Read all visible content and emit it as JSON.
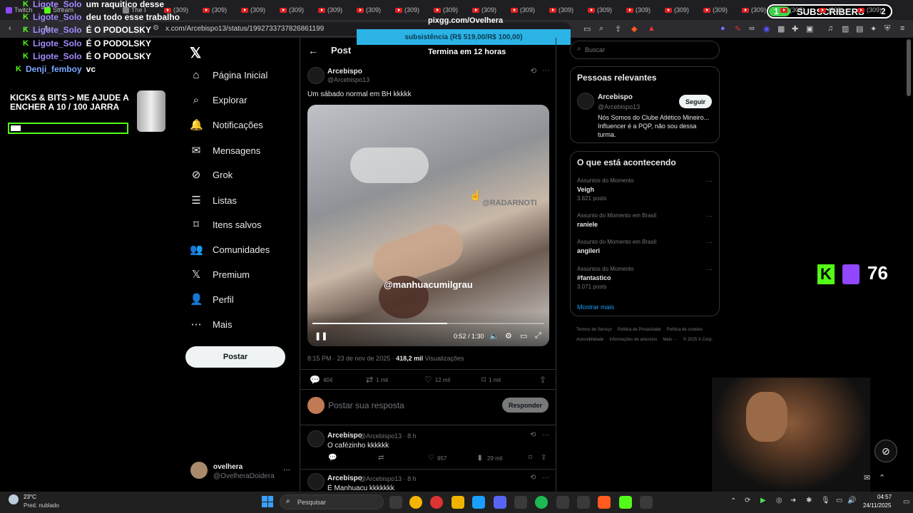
{
  "browser": {
    "tabs": [
      "Twitch",
      "Stream",
      "The I",
      "(309)",
      "(309)",
      "(309)",
      "(309)",
      "(309)",
      "(309)",
      "(309)",
      "(309)",
      "(309)",
      "(309)",
      "(309)",
      "(309)",
      "(309)",
      "(309)",
      "(309)",
      "(309)",
      "(309)",
      "(309)",
      "(309)"
    ],
    "url": "x.com/Arcebispo13/status/1992733737826861199"
  },
  "overlay": {
    "pix_title": "pixgg.com/Ovelhera",
    "pix_goal": "subsistência (R$ 519,00/R$ 100,00)",
    "pix_ends": "Termina em 12 horas",
    "subs_left": "1",
    "subs_label": "SUBSCRIBERS",
    "subs_right": "2",
    "chat": [
      {
        "user": "Ligote_Solo",
        "msg": "um raquitico desse"
      },
      {
        "user": "Ligote_Solo",
        "msg": "deu todo esse trabalho"
      },
      {
        "user": "Ligote_Solo",
        "msg": "É O PODOLSKY"
      },
      {
        "user": "Ligote_Solo",
        "msg": "É O PODOLSKY"
      },
      {
        "user": "Ligote_Solo",
        "msg": "É O PODOLSKY"
      },
      {
        "user": "Denji_femboy",
        "msg": "vc"
      }
    ],
    "goal_text": "KICKS & BITS > ME AJUDE A ENCHER A  10   / 100 JARRA",
    "viewer_count": "76"
  },
  "x_nav": {
    "items": [
      {
        "label": "Página Inicial",
        "icon": "home-icon"
      },
      {
        "label": "Explorar",
        "icon": "search-icon"
      },
      {
        "label": "Notificações",
        "icon": "bell-icon"
      },
      {
        "label": "Mensagens",
        "icon": "mail-icon"
      },
      {
        "label": "Grok",
        "icon": "grok-icon"
      },
      {
        "label": "Listas",
        "icon": "list-icon"
      },
      {
        "label": "Itens salvos",
        "icon": "bookmark-icon"
      },
      {
        "label": "Comunidades",
        "icon": "communities-icon"
      },
      {
        "label": "Premium",
        "icon": "x-icon"
      },
      {
        "label": "Perfil",
        "icon": "profile-icon"
      },
      {
        "label": "Mais",
        "icon": "more-icon"
      }
    ],
    "post_button": "Postar",
    "account_name": "ovelhera",
    "account_handle": "@OvelheraDoidera"
  },
  "post": {
    "header": "Post",
    "author": "Arcebispo",
    "handle": "@Arcebispo13",
    "text": "Um sábado normal em BH kkkkk",
    "video_watermark": "@manhuacumilgrau",
    "video_watermark2": "@RADARNOTI",
    "video_time": "0:52 / 1:30",
    "video_progress": 0.58,
    "meta_time": "8:15 PM · 23 de nov de 2025",
    "views": "418,2 mil",
    "views_label": "Visualizações",
    "replies": "404",
    "reposts": "1 mil",
    "likes": "12 mil",
    "bookmarks": "1 mil",
    "reply_placeholder": "Postar sua resposta",
    "reply_button": "Responder"
  },
  "replies": [
    {
      "author": "Arcebispo",
      "handle": "@Arcebispo13 · 8 h",
      "text": "O cafézinho kkkkkk",
      "likes": "957",
      "views": "29 mil"
    },
    {
      "author": "Arcebispo",
      "handle": "@Arcebispo13 · 8 h",
      "text": "É Manhuacu kkkkkkk"
    }
  ],
  "sidebar": {
    "search_placeholder": "Buscar",
    "relevant_title": "Pessoas relevantes",
    "relevant_name": "Arcebispo",
    "relevant_handle": "@Arcebispo13",
    "follow_label": "Seguir",
    "relevant_bio": "Nós Somos do Clube Atlético Mineiro... Influencer é a PQP, não sou dessa turma.",
    "trends_title": "O que está acontecendo",
    "trends": [
      {
        "sub": "Assuntos do Momento",
        "title": "Veigh",
        "count": "3.821 posts"
      },
      {
        "sub": "Assunto do Momento em Brasil",
        "title": "raniele",
        "count": ""
      },
      {
        "sub": "Assunto do Momento em Brasil",
        "title": "angileri",
        "count": ""
      },
      {
        "sub": "Assuntos do Momento",
        "title": "#fantastico",
        "count": "3.071 posts"
      }
    ],
    "show_more": "Mostrar mais",
    "footer": [
      "Termos de Serviço",
      "Política de Privacidade",
      "Política de cookies",
      "Acessibilidade",
      "Informações de anúncios",
      "Mais ···",
      "© 2025 X Corp."
    ]
  },
  "taskbar": {
    "weather_temp": "23°C",
    "weather_desc": "Pred. nublado",
    "search": "Pesquisar",
    "time": "04:57",
    "date": "24/11/2025"
  }
}
